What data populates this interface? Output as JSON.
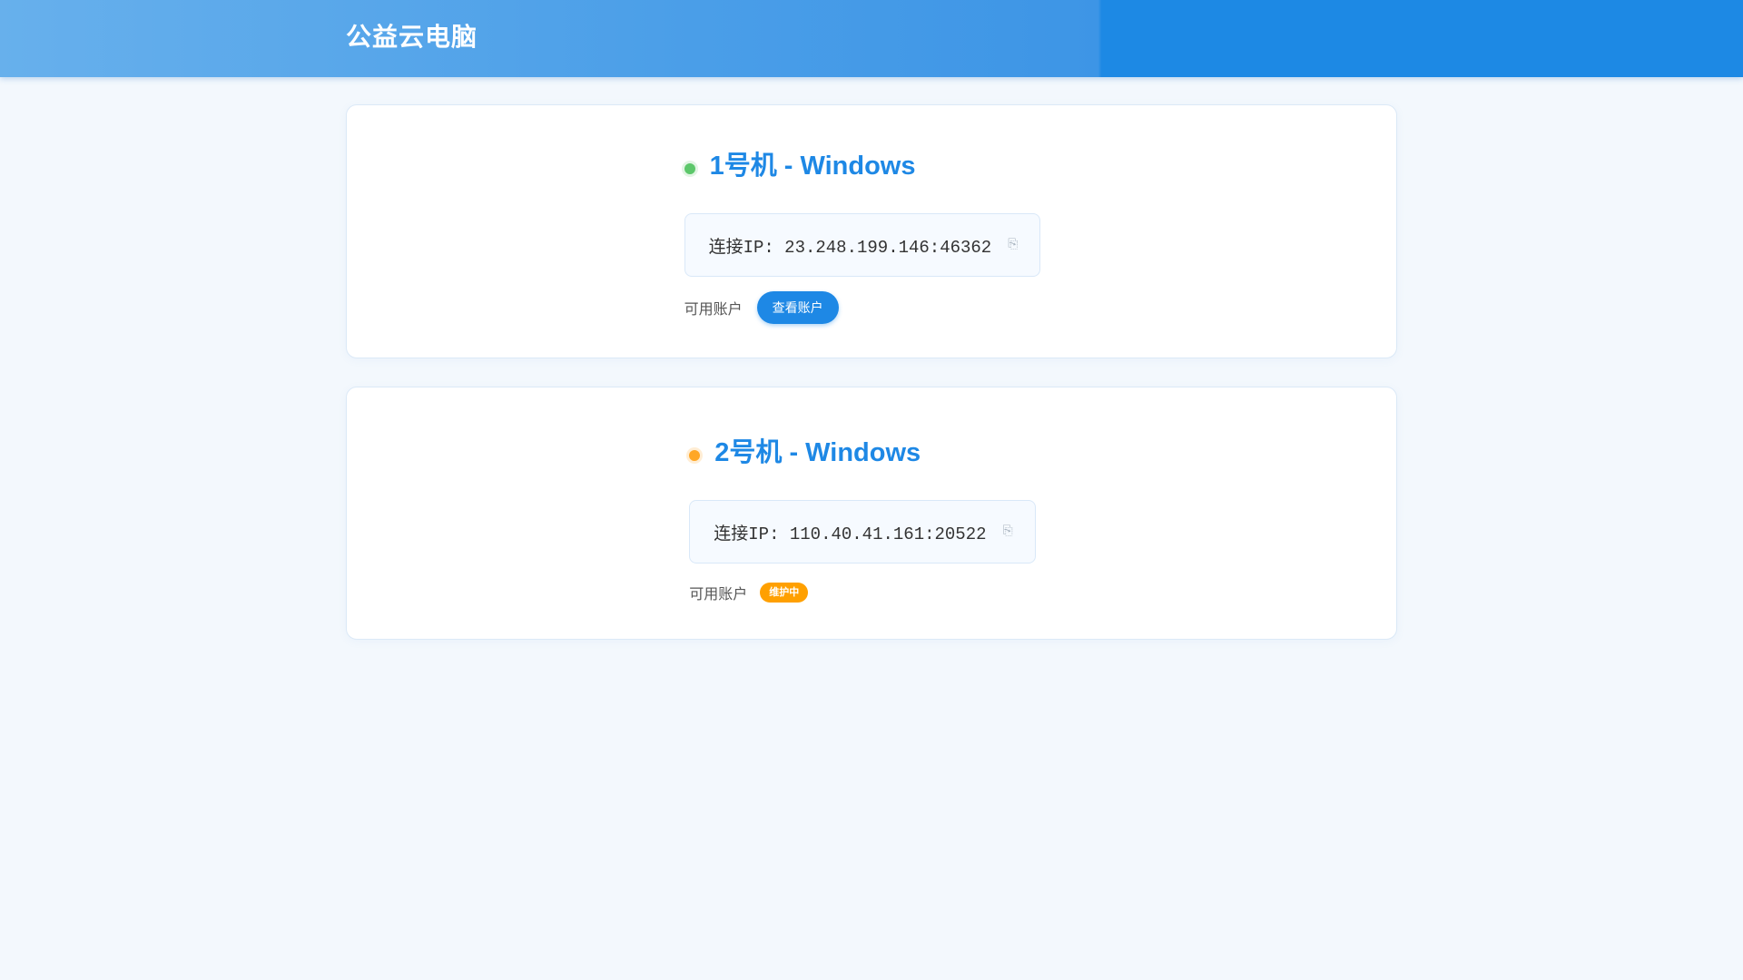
{
  "header": {
    "title": "公益云电脑"
  },
  "machines": [
    {
      "title": "1号机 - Windows",
      "status": "online",
      "status_color": "#5cc76a",
      "ip_line": "连接IP: 23.248.199.146:46362",
      "copy_icon": "⎘",
      "account_label": "可用账户",
      "action_label": "查看账户"
    },
    {
      "title": "2号机 - Windows",
      "status": "maintenance",
      "status_color": "#ffa726",
      "ip_line": "连接IP: 110.40.41.161:20522",
      "copy_icon": "⎘",
      "account_label": "可用账户",
      "badge_label": "维护中"
    }
  ],
  "colors": {
    "accent": "#1e88e5",
    "header_dark": "#1d89e4",
    "maintenance": "#ffa000",
    "background": "#f3f8fd"
  }
}
